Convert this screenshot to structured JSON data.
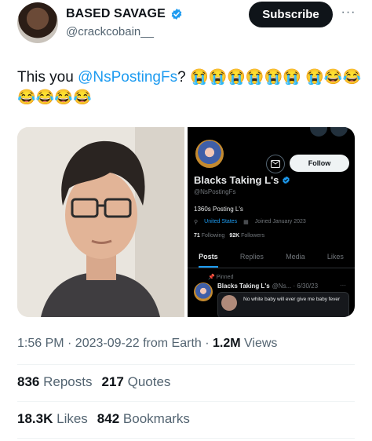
{
  "author": {
    "display_name": "BASED SAVAGE",
    "handle": "@crackcobain__"
  },
  "header": {
    "subscribe_label": "Subscribe",
    "more_glyph": "···"
  },
  "tweet": {
    "text_prefix": "This you ",
    "mention": "@NsPostingFs",
    "text_suffix": "? 😭😭😭😭😭😭 😭😂😂😂😂😂😂"
  },
  "screenshot": {
    "follow_label": "Follow",
    "name": "Blacks Taking L's",
    "handle": "@NsPostingFs",
    "bio": "1360s Posting L's",
    "location": "United States",
    "joined": "Joined January 2023",
    "following_count": "71",
    "following_label": "Following",
    "followers_count": "92K",
    "followers_label": "Followers",
    "tabs": [
      "Posts",
      "Replies",
      "Media",
      "Likes"
    ],
    "pinned_label": "Pinned",
    "post_name": "Blacks Taking L's",
    "post_meta": "@Ns... · 6/30/23",
    "post_more": "···",
    "quote_text": "No white baby will ever give me baby fever"
  },
  "meta": {
    "time": "1:56 PM · 2023-09-22 from Earth · ",
    "views_count": "1.2M",
    "views_label": " Views"
  },
  "stats": {
    "reposts_count": "836",
    "reposts_label": "Reposts",
    "quotes_count": "217",
    "quotes_label": "Quotes",
    "likes_count": "18.3K",
    "likes_label": "Likes",
    "bookmarks_count": "842",
    "bookmarks_label": "Bookmarks"
  },
  "colors": {
    "accent": "#1d9bf0",
    "text": "#0f1419",
    "muted": "#536471"
  }
}
